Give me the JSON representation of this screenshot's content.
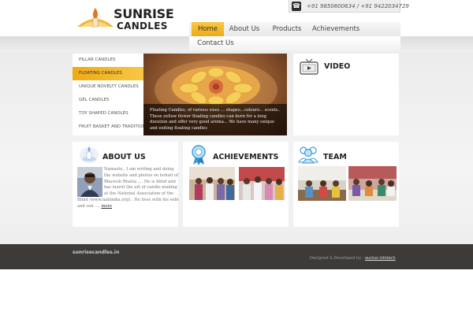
{
  "brand": {
    "line1": "SUNRISE",
    "line2": "CANDLES"
  },
  "contact": {
    "phones": "+91 9850600634 / +91 9422034729",
    "icon": "phone-icon"
  },
  "nav": {
    "items": [
      {
        "label": "Home",
        "active": true
      },
      {
        "label": "About Us"
      },
      {
        "label": "Products"
      },
      {
        "label": "Achievements"
      },
      {
        "label": "Contact Us"
      }
    ]
  },
  "categories": [
    {
      "label": "PILLAR CANDLES"
    },
    {
      "label": "FLOATING CANDLES",
      "active": true
    },
    {
      "label": "UNIQUE NOVELTY CANDLES"
    },
    {
      "label": "GEL CANDLES"
    },
    {
      "label": "TOY SHAPED CANDLES"
    },
    {
      "label": "FRUIT BASKET AND TRADITIONAL"
    }
  ],
  "feature": {
    "caption": "Floating Candles, of various sizes ... shapes...colours... scents.. These yellow flower floating candles can burn for a long duration and offer very good aroma... We have many unique and exiting floating candles"
  },
  "video": {
    "title": "VIDEO",
    "icon": "tv-icon"
  },
  "about": {
    "title": "ABOUT US",
    "icon": "candle-icon",
    "text": "Namaste.. I am writing and doing the website and photos on behalf of Bhavesh Bhatia .... He is blind and has learnt the art of candle making at the National Association of the Blind (www.nabindia.org).. He lives with his wife and son .... ",
    "more": "more"
  },
  "achievements": {
    "title": "ACHIEVEMENTS",
    "icon": "ribbon-icon"
  },
  "team": {
    "title": "TEAM",
    "icon": "people-icon"
  },
  "footer": {
    "site": "sunrisecandles.in",
    "credit_prefix": "Designed & Developed by : ",
    "credit_company": "auctus infotech"
  },
  "colors": {
    "accent": "#f0a914",
    "footer_bg": "#3e3a37"
  }
}
